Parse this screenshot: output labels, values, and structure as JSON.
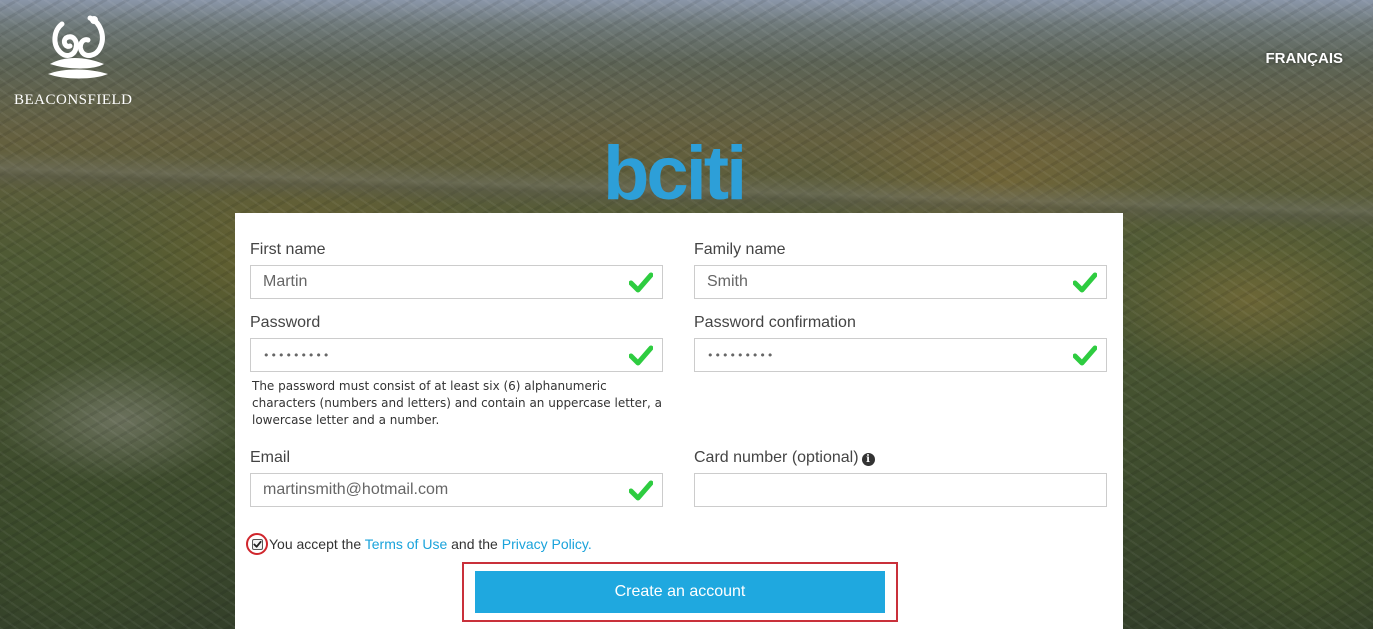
{
  "header": {
    "org_name": "BEACONSFIELD",
    "language_link": "FRANÇAIS",
    "brand_name": "bciti"
  },
  "form": {
    "first_name": {
      "label": "First name",
      "value": "Martin",
      "valid": true
    },
    "family_name": {
      "label": "Family name",
      "value": "Smith",
      "valid": true
    },
    "password": {
      "label": "Password",
      "value": "•••••••••",
      "valid": true
    },
    "password_confirmation": {
      "label": "Password confirmation",
      "value": "•••••••••",
      "valid": true
    },
    "password_hint": "The password must consist of at least six (6) alphanumeric characters (numbers and letters) and contain an uppercase letter, a lowercase letter and a number.",
    "email": {
      "label": "Email",
      "value": "martinsmith@hotmail.com",
      "valid": true
    },
    "card_number": {
      "label": "Card number (optional)",
      "value": ""
    },
    "consent": {
      "checked": true,
      "prefix": "You accept the",
      "terms_link": "Terms of Use",
      "middle": "and the",
      "privacy_link": "Privacy Policy."
    },
    "submit_label": "Create an account"
  },
  "colors": {
    "accent": "#1fa8df",
    "link": "#1aa3db",
    "valid_check": "#2ecc40",
    "annotation_red": "#c9303a"
  }
}
